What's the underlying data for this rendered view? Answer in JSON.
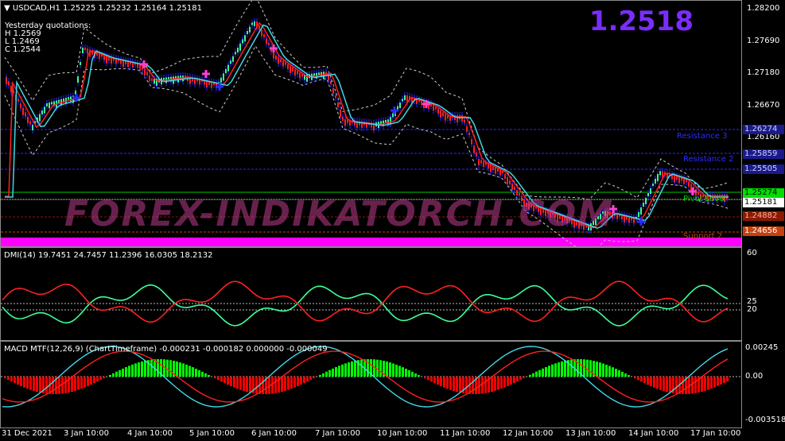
{
  "main_chart": {
    "header": "USDCAD,H1  1.25225 1.25232 1.25164 1.25181",
    "yesterday_title": "Yesterday quotations:",
    "yesterday_high": "H 1.2569",
    "yesterday_low": "L 1.2469",
    "yesterday_close": "C 1.2544",
    "big_price": "1.2518",
    "watermark": "FOREX-INDIKATORCH.COM",
    "y_ticks": [
      "1.28200",
      "1.27690",
      "1.27180",
      "1.26670",
      "1.26160"
    ],
    "pivot_labels": {
      "resistance3": "Resistance 3",
      "resistance2": "Resistance 2",
      "pivot": "Pivot Level",
      "support2": "Support 2"
    },
    "price_tags": {
      "r3": "1.26274",
      "r2": "1.25859",
      "r1": "1.25505",
      "current_green": "1.25274",
      "current_white": "1.25181",
      "s1": "1.24882",
      "s2": "1.24656"
    },
    "colors": {
      "bull_candle": "#3dff9a",
      "bear_candle": "#ff2020",
      "ma_cyan": "#3fd8e6",
      "bands": "#cfcfcf",
      "resistance": "#2a2aff",
      "support": "#c84010",
      "pivot": "#00c800",
      "big_price": "#7b2cff",
      "histogram_bar": "#ff00ff"
    }
  },
  "dmi_panel": {
    "header": "DMI(14) 19.7451 24.7457 11.2396 16.0305 18.2132",
    "y_ticks": [
      "60",
      "25",
      "20"
    ]
  },
  "macd_panel": {
    "header": "MACD MTF(12,26,9) (ChartTimeframe) -0.000231 -0.000182 0.000000 -0.000049",
    "y_ticks": [
      "0.00245",
      "0.00",
      "-0.003518"
    ]
  },
  "x_axis": {
    "labels": [
      "31 Dec 2021",
      "3 Jan 10:00",
      "4 Jan 10:00",
      "5 Jan 10:00",
      "6 Jan 10:00",
      "7 Jan 10:00",
      "10 Jan 10:00",
      "11 Jan 10:00",
      "12 Jan 10:00",
      "13 Jan 10:00",
      "14 Jan 10:00",
      "17 Jan 10:00"
    ]
  }
}
